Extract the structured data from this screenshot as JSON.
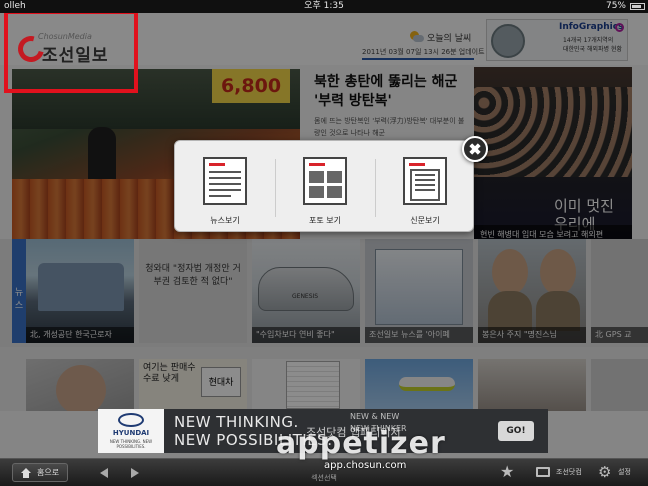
{
  "status_bar": {
    "carrier": "olleh",
    "time": "오후 1:35",
    "battery": "75%"
  },
  "header": {
    "logo_en": "ChosunMedia",
    "logo_ko": "조선일보",
    "weather_label": "오늘의 날씨",
    "update_time": "2011년 03월 07일 13시 26분 업데이트"
  },
  "infographics": {
    "title": "InfoGraphics",
    "line1": "14개국 17개지역의",
    "line2": "대한민국 해외파병 현황"
  },
  "hero": {
    "price_tag": "6,800",
    "headline": "북한 총탄에 뚫리는 해군 '부력 방탄복'",
    "summary": "몸에 뜨는 방탄복인 '부력(浮力)방탄복' 대부분이 불량인 것으로 나타나 해군"
  },
  "side_story": {
    "banner_text": "이미 멋진\n우리에",
    "caption": "현빈 해병대 입대 모습 보려고 해외편"
  },
  "section_tab": "뉴스",
  "tiles": [
    {
      "caption": "北, 개성공단 한국근로자"
    },
    {
      "quote": "청와대 \"정자법 개정안 거부권 검토한 적 없다\"",
      "caption": ""
    },
    {
      "car_badge": "GENESIS",
      "caption": "\"수입차보다 연비 좋다\""
    },
    {
      "caption": "조선일보 뉴스를 '아이폐"
    },
    {
      "caption": "봉은사 주지 \"명진스님"
    },
    {
      "caption": "北 GPS 교"
    }
  ],
  "row3": {
    "ad_text": "여기는 판매수수료 낮게",
    "ad_box": "현대차"
  },
  "popup": {
    "items": [
      {
        "label": "뉴스보기",
        "icon": "news-icon"
      },
      {
        "label": "포토 보기",
        "icon": "photo-icon"
      },
      {
        "label": "신문보기",
        "icon": "newspaper-icon"
      }
    ]
  },
  "ad_banner": {
    "brand": "HYUNDAI",
    "brand_tag": "NEW THINKING. NEW POSSIBILITIES.",
    "headline_line1": "NEW THINKING.",
    "headline_line2": "NEW POSSIBILITIES.",
    "sub_line1": "NEW & NEW",
    "sub_line2": "NEW THINKER",
    "cta": "GO!"
  },
  "toolbar": {
    "home_label": "홈으로",
    "middle_label": "섹션선택",
    "site_label": "조선닷컴",
    "settings_label": "설정"
  },
  "watermark": {
    "brand": "appetizer",
    "overlay": "조선닷컴 앱패티이저",
    "url": "app.chosun.com"
  },
  "colors": {
    "brand_red": "#e1111d",
    "section_blue": "#3a72c6"
  }
}
